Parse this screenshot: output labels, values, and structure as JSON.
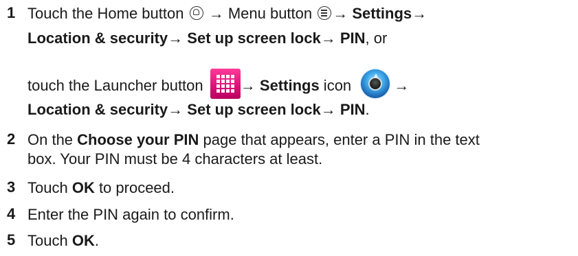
{
  "steps": [
    {
      "number": "1",
      "lines": {
        "l1": {
          "t1": "Touch the Home button ",
          "t2": " → Menu button ",
          "t3": "→ ",
          "b1": "Settings",
          "t4": "→"
        },
        "l2": {
          "b1": "Location & security",
          "t1": "→ ",
          "b2": "Set up screen lock",
          "t2": "→ ",
          "b3": "PIN",
          "t3": ", or"
        },
        "l3": {
          "t1": "touch the Launcher button ",
          "t2": "→ ",
          "b1": "Settings",
          "t3": " icon ",
          "t4": "→"
        },
        "l4": {
          "b1": "Location & security",
          "t1": "→ ",
          "b2": "Set up screen lock",
          "t2": "→ ",
          "b3": "PIN",
          "t3": "."
        }
      }
    },
    {
      "number": "2",
      "lines": {
        "l1": {
          "t1": "On the ",
          "b1": "Choose your PIN",
          "t2": " page that appears, enter a PIN in the text"
        },
        "l2": {
          "t1": "box. Your PIN must be 4 characters at least."
        }
      }
    },
    {
      "number": "3",
      "lines": {
        "l1": {
          "t1": "Touch ",
          "b1": "OK",
          "t2": " to proceed."
        }
      }
    },
    {
      "number": "4",
      "lines": {
        "l1": {
          "t1": "Enter the PIN again to confirm."
        }
      }
    },
    {
      "number": "5",
      "lines": {
        "l1": {
          "t1": "Touch ",
          "b1": "OK",
          "t2": "."
        }
      }
    }
  ],
  "icons": {
    "home": "home-button-icon",
    "menu": "menu-button-icon",
    "launcher": "launcher-button-icon",
    "settings": "settings-app-icon"
  }
}
